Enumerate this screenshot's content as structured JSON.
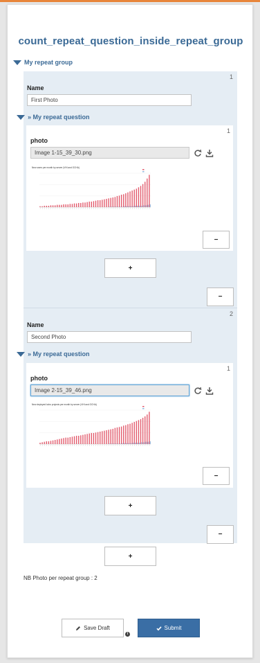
{
  "form": {
    "title": "count_repeat_question_inside_repeat_group",
    "group_label": "My repeat group",
    "question_label": "» My repeat question",
    "field_name_label": "Name",
    "field_photo_label": "photo",
    "instances": [
      {
        "number": "1",
        "name_value": "First Photo",
        "sub_number": "1",
        "photo_file": "Image 1-15_39_30.png",
        "chart_title": "New users per month by server (VHI and OCHA)"
      },
      {
        "number": "2",
        "name_value": "Second Photo",
        "sub_number": "1",
        "photo_file": "Image 2-15_39_46.png",
        "chart_title": "New deployed kobo projects per month by server (VHI and OCHA)"
      }
    ],
    "add_label": "+",
    "remove_label": "−",
    "nb_photo_text": "NB Photo per repeat group : 2",
    "save_draft_label": "Save Draft",
    "submit_label": "Submit",
    "info_glyph": "i"
  },
  "colors": {
    "accent": "#3b6a96",
    "panel": "#e5edf4",
    "submit": "#3a6ea5",
    "topbar": "#e8853a",
    "bar_series_1": "#e25a6c",
    "bar_series_2": "#8fb9e0"
  },
  "icons": {
    "refresh": "refresh-icon",
    "download": "download-icon",
    "save": "pencil-icon",
    "submit": "check-icon"
  },
  "chart_data": [
    {
      "type": "bar",
      "title": "New users per month by server (VHI and OCHA)",
      "series": [
        {
          "values": [
            2,
            2,
            3,
            3,
            3,
            4,
            4,
            4,
            5,
            5,
            5,
            6,
            6,
            6,
            7,
            7,
            8,
            8,
            9,
            9,
            10,
            10,
            11,
            12,
            12,
            13,
            14,
            15,
            15,
            16,
            17,
            18,
            19,
            20,
            21,
            22,
            24,
            25,
            27,
            28,
            30,
            32,
            34,
            36,
            38,
            40,
            43,
            46,
            50,
            55,
            62,
            70
          ]
        },
        {
          "values": [
            0,
            0,
            0,
            0,
            0,
            0,
            0,
            0,
            0,
            0,
            0,
            0,
            0,
            0,
            0,
            0,
            0,
            0,
            0,
            0,
            0,
            0,
            0,
            0,
            0,
            0,
            0,
            0,
            0,
            0,
            0,
            0,
            1,
            1,
            1,
            1,
            1,
            1,
            1,
            2,
            2,
            2,
            2,
            2,
            3,
            3,
            3,
            3,
            4,
            4,
            5,
            6
          ]
        }
      ]
    },
    {
      "type": "bar",
      "title": "New deployed kobo projects per month by server (VHI and OCHA)",
      "series": [
        {
          "values": [
            3,
            4,
            5,
            6,
            6,
            7,
            8,
            9,
            10,
            11,
            12,
            13,
            14,
            14,
            15,
            16,
            17,
            18,
            18,
            19,
            20,
            21,
            22,
            23,
            24,
            24,
            25,
            26,
            27,
            28,
            29,
            30,
            31,
            32,
            33,
            35,
            36,
            37,
            38,
            40,
            41,
            43,
            44,
            46,
            48,
            50,
            52,
            54,
            57,
            60,
            64,
            70
          ]
        },
        {
          "values": [
            0,
            0,
            0,
            0,
            0,
            0,
            0,
            0,
            0,
            0,
            0,
            0,
            0,
            0,
            0,
            0,
            0,
            0,
            0,
            0,
            0,
            0,
            0,
            0,
            0,
            0,
            0,
            0,
            0,
            0,
            0,
            0,
            1,
            1,
            1,
            1,
            1,
            1,
            2,
            2,
            2,
            2,
            2,
            3,
            3,
            3,
            3,
            4,
            4,
            5,
            5,
            6
          ]
        }
      ]
    }
  ]
}
